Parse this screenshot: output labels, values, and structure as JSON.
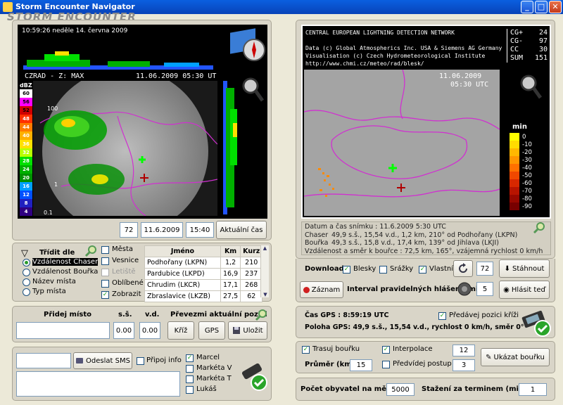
{
  "window": {
    "title": "Storm Encounter Navigator",
    "logo": "STORM ENCOUNTER",
    "min": "_",
    "max": "□",
    "close": "✕"
  },
  "radar": {
    "timestamp": "10:59:26 neděle 14. června 2009",
    "header_left": "CZRAD - Z: MAX",
    "header_right": "11.06.2009 05:30 UT",
    "dbz_label": "dBZ",
    "scale": [
      "60",
      "56",
      "52",
      "48",
      "44",
      "40",
      "36",
      "32",
      "28",
      "24",
      "20",
      "16",
      "12",
      "8",
      "4"
    ],
    "scale_colors": [
      "#ffffff",
      "#ff00ff",
      "#d00000",
      "#ff3000",
      "#ff7a00",
      "#ffb000",
      "#ffe000",
      "#b8ff00",
      "#00e000",
      "#00b000",
      "#009000",
      "#00a0ff",
      "#0050ff",
      "#2020c0",
      "#300080"
    ]
  },
  "radar_controls": {
    "first": "|◀",
    "prev": "◀◀",
    "play": "▶",
    "next": "▶▶",
    "last": "▶|",
    "count": "72",
    "date": "11.6.2009",
    "time": "15:40",
    "current": "Aktuální čas"
  },
  "sort": {
    "title": "Třídit dle",
    "options": [
      {
        "label": "Vzdálenost Chaser",
        "selected": true
      },
      {
        "label": "Vzdálenost Bouřka",
        "selected": false
      },
      {
        "label": "Název místa",
        "selected": false
      },
      {
        "label": "Typ místa",
        "selected": false
      }
    ]
  },
  "filters": [
    {
      "label": "Města",
      "checked": false
    },
    {
      "label": "Vesnice",
      "checked": false
    },
    {
      "label": "Letiště",
      "checked": false
    },
    {
      "label": "Oblíbené",
      "checked": false
    },
    {
      "label": "Zobrazit",
      "checked": true
    }
  ],
  "places": {
    "headers": [
      "Jméno",
      "Km",
      "Kurz"
    ],
    "rows": [
      [
        "Podhořany (LKPN)",
        "1,2",
        "210"
      ],
      [
        "Pardubice (LKPD)",
        "16,9",
        "237"
      ],
      [
        "Chrudim (LKCR)",
        "17,1",
        "268"
      ],
      [
        "Zbraslavice (LKZB)",
        "27,5",
        "62"
      ]
    ]
  },
  "add_place": {
    "title": "Přidej místo",
    "ss_label": "s.š.",
    "vd_label": "v.d.",
    "ss_value": "0.00",
    "vd_value": "0.00",
    "take_pos": "Převezmi aktuální pozici",
    "cross": "Kříž",
    "gps": "GPS",
    "save": "Uložit"
  },
  "sms": {
    "send": "Odeslat SMS",
    "attach": "Připoj info",
    "recipients": [
      {
        "label": "Marcel",
        "checked": true
      },
      {
        "label": "Markéta V",
        "checked": false
      },
      {
        "label": "Markéta T",
        "checked": false
      },
      {
        "label": "Lukáš",
        "checked": false
      }
    ]
  },
  "lightning": {
    "header_lines": [
      "CENTRAL EUROPEAN LIGHTNING DETECTION NETWORK",
      "",
      "Data (c) Global Atmospherics Inc. USA & Siemens AG Germany",
      "Visualisation (c) Czech Hydrometeorological Institute",
      "http://www.chmi.cz/meteo/rad/blesk/"
    ],
    "stats": [
      [
        "CG+",
        "24"
      ],
      [
        "CG-",
        "97"
      ],
      [
        "CC",
        "30"
      ],
      [
        "SUM",
        "151"
      ]
    ],
    "date": "11.06.2009",
    "time": "05:30 UTC",
    "legend_title": "min",
    "legend": [
      "0",
      "-10",
      "-20",
      "-30",
      "-40",
      "-50",
      "-60",
      "-70",
      "-80",
      "-90"
    ],
    "legend_colors": [
      "#ffff00",
      "#ffdc00",
      "#ffb800",
      "#ff9600",
      "#ff7000",
      "#f04800",
      "#d82800",
      "#b81400",
      "#980800",
      "#780000"
    ]
  },
  "info": {
    "line1": "Datum a čas snímku : 11.6.2009 5:30 UTC",
    "chaser_label": "Chaser",
    "chaser": "49,9 s.š., 15,54 v.d., 1,2 km, 210° od Podhořany (LKPN)",
    "storm_label": "Bouřka",
    "storm": "49,3 s.š., 15,8 v.d., 17,4 km, 139° od Jihlava (LKJI)",
    "distance": "Vzdálenost a směr k bouřce : 72,5 km, 165°, vzájemná rychlost 0 km/h"
  },
  "download": {
    "label": "Download",
    "items": [
      {
        "label": "Blesky",
        "checked": true
      },
      {
        "label": "Srážky",
        "checked": false
      },
      {
        "label": "Vlastní",
        "checked": true
      }
    ],
    "count": "72",
    "button": "Stáhnout"
  },
  "record": {
    "button": "Záznam",
    "interval_label": "Interval pravidelných hlášení (min)",
    "interval": "5",
    "report": "Hlásit teď"
  },
  "gps": {
    "time": "Čas GPS : 8:59:19 UTC",
    "position": "Poloha GPS:  49,9 s.š., 15,54 v.d., rychlost 0 km/h, směr 0°",
    "pass_cross": "Předávej pozici kříži"
  },
  "track": {
    "track_storm": "Trasuj bouřku",
    "interpolation": "Interpolace",
    "interp_value": "12",
    "avg_label": "Průměr (km)",
    "avg_value": "15",
    "predict": "Předvídej postup",
    "predict_value": "3",
    "show": "Ukázat bouřku"
  },
  "population": {
    "label": "Počet obyvatel na město",
    "value": "5000",
    "dl_label": "Stažení za terminem (min)",
    "dl_value": "1"
  }
}
